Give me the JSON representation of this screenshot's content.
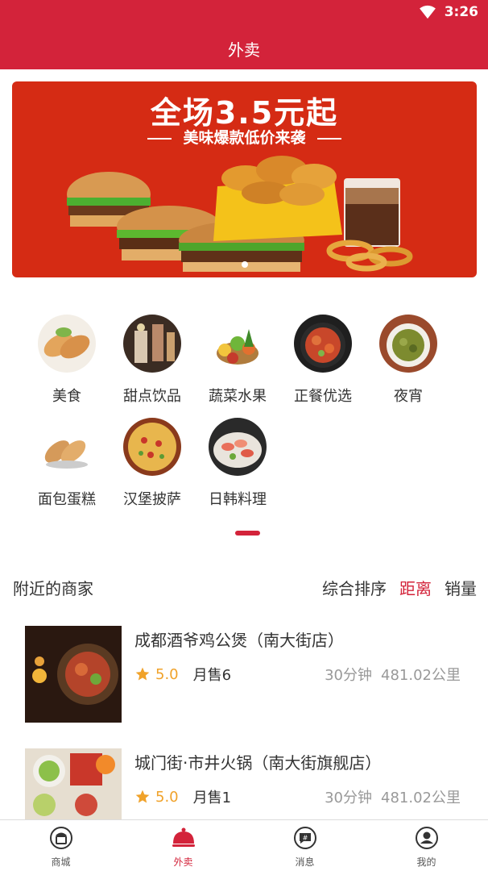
{
  "statusbar": {
    "time": "3:26"
  },
  "appbar": {
    "title": "外卖"
  },
  "banner": {
    "headline": "全场3.5元起",
    "subline": "美味爆款低价来袭"
  },
  "categories": [
    {
      "label": "美食"
    },
    {
      "label": "甜点饮品"
    },
    {
      "label": "蔬菜水果"
    },
    {
      "label": "正餐优选"
    },
    {
      "label": "夜宵"
    },
    {
      "label": "面包蛋糕"
    },
    {
      "label": "汉堡披萨"
    },
    {
      "label": "日韩料理"
    }
  ],
  "nearby": {
    "title": "附近的商家",
    "sorts": [
      {
        "label": "综合排序"
      },
      {
        "label": "距离"
      },
      {
        "label": "销量"
      }
    ]
  },
  "shops": [
    {
      "name": "成都酒爷鸡公煲（南大街店）",
      "score": "5.0",
      "sales": "月售6",
      "time": "30分钟",
      "distance": "481.02公里"
    },
    {
      "name": "城门街·市井火锅（南大街旗舰店）",
      "score": "5.0",
      "sales": "月售1",
      "time": "30分钟",
      "distance": "481.02公里"
    }
  ],
  "tabbar": [
    {
      "label": "商城",
      "icon": "shop-icon"
    },
    {
      "label": "外卖",
      "icon": "takeaway-cloche-icon"
    },
    {
      "label": "消息",
      "icon": "message-icon"
    },
    {
      "label": "我的",
      "icon": "profile-icon"
    }
  ],
  "colors": {
    "primary": "#d3233a",
    "rating": "#f0a22a",
    "muted": "#999999"
  }
}
